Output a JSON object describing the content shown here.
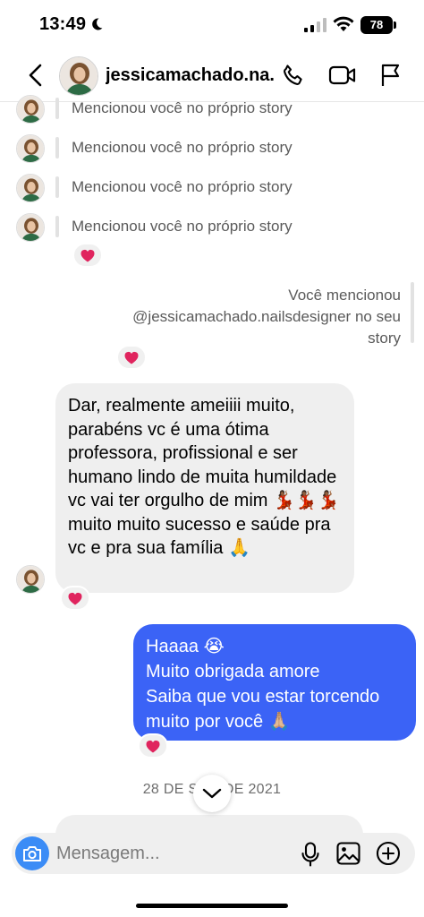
{
  "status_bar": {
    "time": "13:49",
    "battery": "78"
  },
  "header": {
    "username": "jessicamachado.na..."
  },
  "thread": {
    "mentions": [
      "Mencionou você no próprio story",
      "Mencionou você no próprio story",
      "Mencionou você no próprio story",
      "Mencionou você no próprio story"
    ],
    "reaction_emoji": "❤️",
    "you_mentioned": {
      "line1": "Você mencionou",
      "line2": "@jessicamachado.nailsdesigner no seu",
      "line3": "story"
    },
    "incoming_message": "Dar, realmente ameiiii muito, parabéns vc é uma ótima professora, profissional e ser humano lindo de muita humildade vc vai ter orgulho de mim 💃🏾💃🏾💃🏾 muito muito sucesso e saúde pra vc e pra sua família 🙏",
    "outgoing_message": {
      "line1": "Haaaa 😭",
      "line2": "Muito obrigada amore",
      "line3": "Saiba que vou estar torcendo",
      "line4": "muito por você 🙏🏼"
    },
    "date_separator": "28 DE S      DE 2021"
  },
  "composer": {
    "placeholder": "Mensagem..."
  },
  "colors": {
    "accent_blue": "#3b63f6",
    "camera_blue": "#3b8cf6",
    "bubble_gray": "#efefef",
    "heart_red": "#e0245e"
  }
}
